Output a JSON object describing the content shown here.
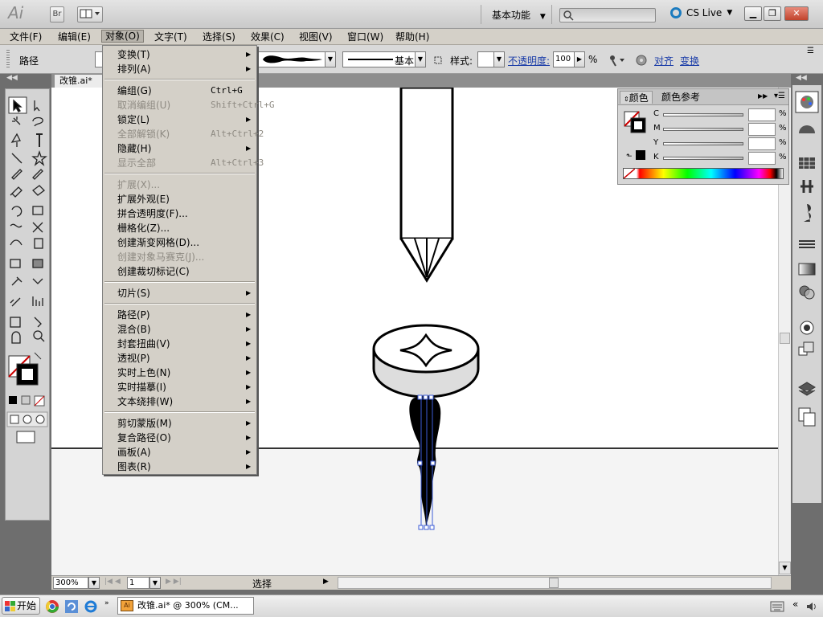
{
  "app": {
    "logo": "Ai",
    "bridge": "Br",
    "workspace": "基本功能",
    "cs_live": "CS Live",
    "search_placeholder": ""
  },
  "menubar": [
    {
      "label": "文件(F)"
    },
    {
      "label": "编辑(E)"
    },
    {
      "label": "对象(O)"
    },
    {
      "label": "文字(T)"
    },
    {
      "label": "选择(S)"
    },
    {
      "label": "效果(C)"
    },
    {
      "label": "视图(V)"
    },
    {
      "label": "窗口(W)"
    },
    {
      "label": "帮助(H)"
    }
  ],
  "controlbar": {
    "selection_label": "路径",
    "stroke_style": "基本",
    "style_label": "样式:",
    "opacity_label": "不透明度:",
    "opacity_value": "100",
    "opacity_unit": "%",
    "align_link": "对齐",
    "transform_link": "变换"
  },
  "document": {
    "tab_label": "改锥.ai*"
  },
  "object_menu": [
    {
      "label": "变换(T)",
      "submenu": true
    },
    {
      "label": "排列(A)",
      "submenu": true
    },
    {
      "sep": true
    },
    {
      "label": "编组(G)",
      "shortcut": "Ctrl+G"
    },
    {
      "label": "取消编组(U)",
      "shortcut": "Shift+Ctrl+G",
      "disabled": true
    },
    {
      "label": "锁定(L)",
      "submenu": true
    },
    {
      "label": "全部解锁(K)",
      "shortcut": "Alt+Ctrl+2",
      "disabled": true
    },
    {
      "label": "隐藏(H)",
      "submenu": true
    },
    {
      "label": "显示全部",
      "shortcut": "Alt+Ctrl+3",
      "disabled": true
    },
    {
      "sep": true
    },
    {
      "label": "扩展(X)...",
      "disabled": true
    },
    {
      "label": "扩展外观(E)"
    },
    {
      "label": "拼合透明度(F)..."
    },
    {
      "label": "栅格化(Z)..."
    },
    {
      "label": "创建渐变网格(D)..."
    },
    {
      "label": "创建对象马赛克(J)...",
      "disabled": true
    },
    {
      "label": "创建裁切标记(C)"
    },
    {
      "sep": true
    },
    {
      "label": "切片(S)",
      "submenu": true
    },
    {
      "sep": true
    },
    {
      "label": "路径(P)",
      "submenu": true
    },
    {
      "label": "混合(B)",
      "submenu": true
    },
    {
      "label": "封套扭曲(V)",
      "submenu": true
    },
    {
      "label": "透视(P)",
      "submenu": true
    },
    {
      "label": "实时上色(N)",
      "submenu": true
    },
    {
      "label": "实时描摹(I)",
      "submenu": true
    },
    {
      "label": "文本绕排(W)",
      "submenu": true
    },
    {
      "sep": true
    },
    {
      "label": "剪切蒙版(M)",
      "submenu": true
    },
    {
      "label": "复合路径(O)",
      "submenu": true
    },
    {
      "label": "画板(A)",
      "submenu": true
    },
    {
      "label": "图表(R)",
      "submenu": true
    }
  ],
  "color_panel": {
    "tabs": [
      "颜色",
      "颜色参考"
    ],
    "channels": [
      {
        "letter": "C",
        "unit": "%"
      },
      {
        "letter": "M",
        "unit": "%"
      },
      {
        "letter": "Y",
        "unit": "%"
      },
      {
        "letter": "K",
        "unit": "%"
      }
    ]
  },
  "status": {
    "zoom": "300%",
    "artboard": "1",
    "tool_mode": "选择"
  },
  "taskbar": {
    "start": "开始",
    "task": "改锥.ai* @ 300% (CM..."
  },
  "colors": {
    "accent": "#1b7bbf",
    "link": "#1a3ca8",
    "red_slash": "#cc0000"
  }
}
